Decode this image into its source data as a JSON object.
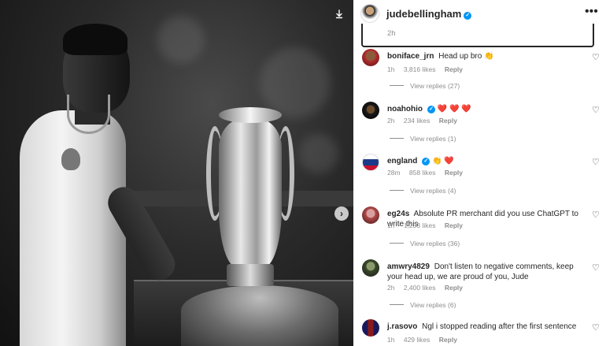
{
  "photo": {
    "download_icon": "download-icon",
    "next_icon": "chevron-right-icon"
  },
  "post": {
    "username": "judebellingham",
    "verified": true,
    "more_icon": "more-horizontal-icon",
    "caption_time": "2h"
  },
  "comments": [
    {
      "user": "boniface_jrn",
      "verified": false,
      "text": "Head up bro 👏",
      "time": "1h",
      "likes": "3,816 likes",
      "reply": "Reply",
      "view_replies": "View replies (27)"
    },
    {
      "user": "noahohio",
      "verified": true,
      "text": "❤️ ❤️ ❤️",
      "time": "2h",
      "likes": "234 likes",
      "reply": "Reply",
      "view_replies": "View replies (1)"
    },
    {
      "user": "england",
      "verified": true,
      "text": "👏 ❤️",
      "time": "28m",
      "likes": "858 likes",
      "reply": "Reply",
      "view_replies": "View replies (4)"
    },
    {
      "user": "eg24s",
      "verified": false,
      "text": "Absolute PR merchant did you use ChatGPT to write this",
      "time": "1h",
      "likes": "1,233 likes",
      "reply": "Reply",
      "view_replies": "View replies (36)"
    },
    {
      "user": "amwry4829",
      "verified": false,
      "text": "Don't listen to negative comments, keep your head up, we are proud of you, Jude",
      "time": "2h",
      "likes": "2,400 likes",
      "reply": "Reply",
      "view_replies": "View replies (6)"
    },
    {
      "user": "j.rasovo",
      "verified": false,
      "text": "Ngl i stopped reading after the first sentence",
      "time": "1h",
      "likes": "429 likes",
      "reply": "Reply"
    }
  ],
  "colors": {
    "verified": "#0095f6",
    "meta_text": "#8e8e8e",
    "primary_text": "#262626"
  }
}
